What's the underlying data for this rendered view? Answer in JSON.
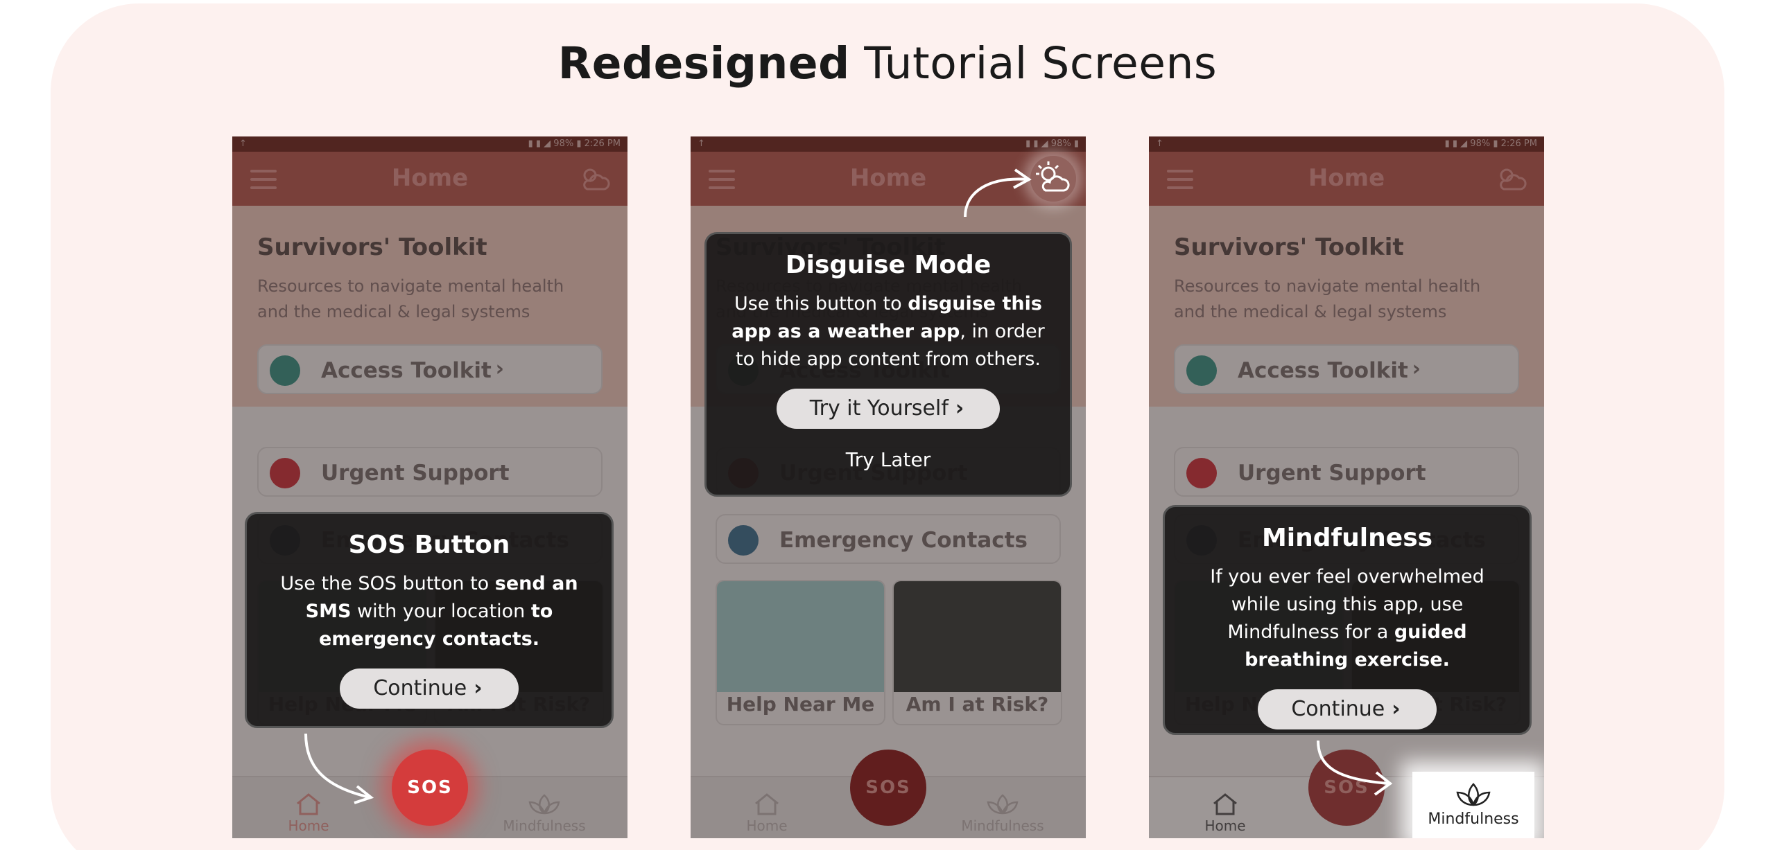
{
  "heading": {
    "bold": "Redesigned",
    "light": "Tutorial Screens"
  },
  "colors": {
    "background": "#fdf1ef",
    "appbar": "#b3594f",
    "sos": "#d43c3c",
    "tooltip": "#1c1a1a"
  },
  "app": {
    "title": "Home",
    "toolkit_title": "Survivors' Toolkit",
    "toolkit_sub": "Resources to navigate mental health and the medical & legal systems",
    "access_label": "Access Toolkit",
    "urgent_label": "Urgent Support",
    "emergency_label": "Emergency Contacts",
    "tile_help": "Help Near Me",
    "tile_risk": "Am I at Risk?",
    "nav_home": "Home",
    "nav_mind": "Mindfulness",
    "sos": "SOS",
    "icons": [
      "menu-icon",
      "weather-icon",
      "home-icon",
      "lotus-icon"
    ]
  },
  "tips": {
    "sos": {
      "title": "SOS Button",
      "body_1": "Use the SOS button to ",
      "body_b1": "send an SMS",
      "body_2": " with your location ",
      "body_b2": "to emergency contacts.",
      "button": "Continue"
    },
    "disguise": {
      "title": "Disguise Mode",
      "body_1": "Use this button to ",
      "body_b1": "disguise this app as a weather app",
      "body_2": ", in order to hide app content from others.",
      "button": "Try it Yourself",
      "later": "Try Later"
    },
    "mind": {
      "title": "Mindfulness",
      "body_1": "If you ever feel overwhelmed while using this app, use Mindfulness for a ",
      "body_b1": "guided breathing exercise.",
      "button": "Continue"
    }
  }
}
